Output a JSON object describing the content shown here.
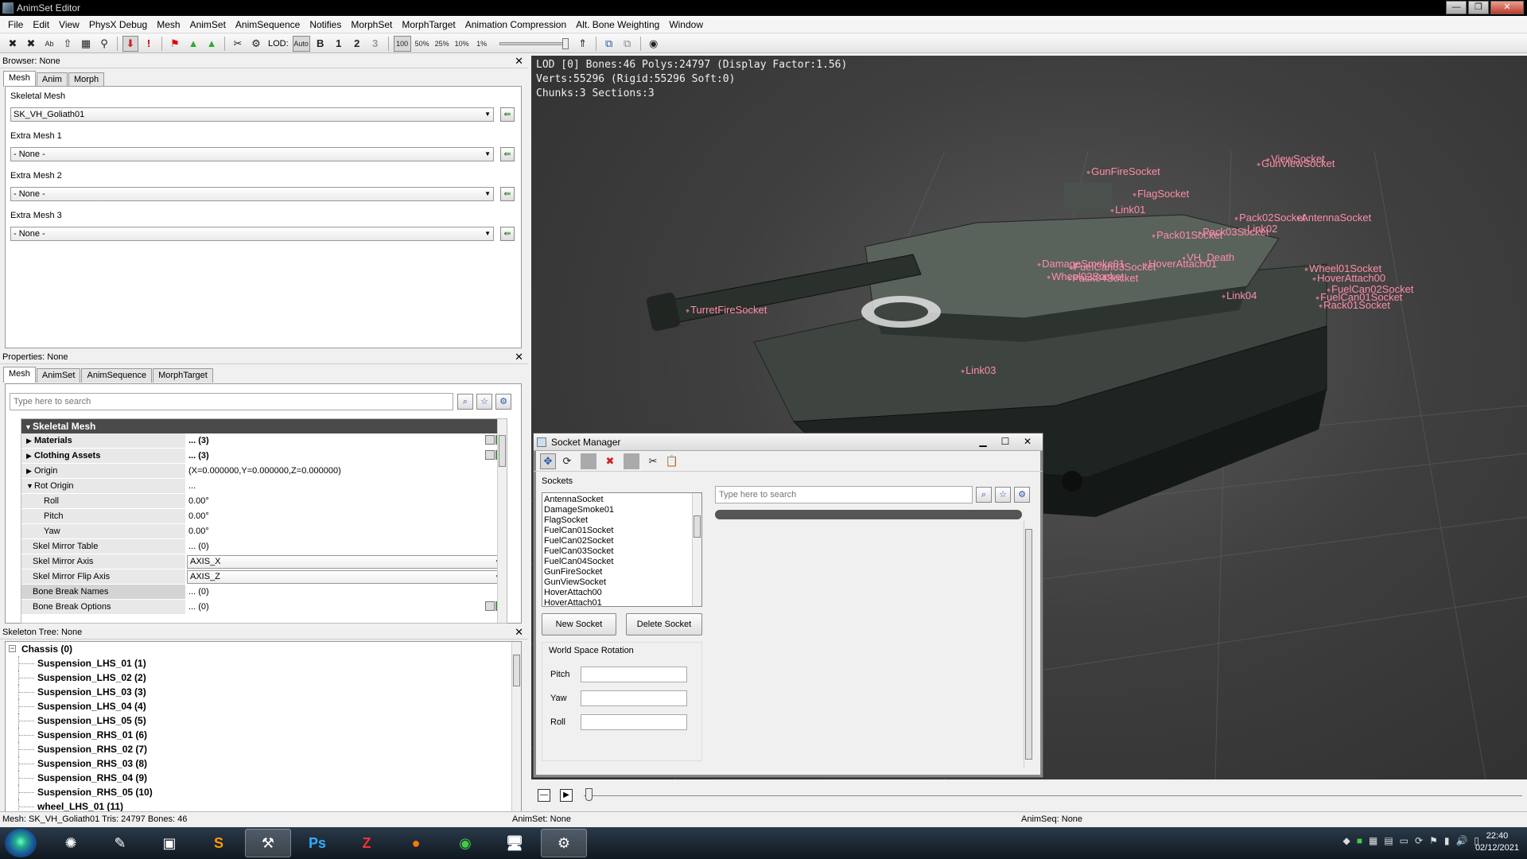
{
  "window": {
    "title": "AnimSet Editor"
  },
  "menu": [
    "File",
    "Edit",
    "View",
    "PhysX Debug",
    "Mesh",
    "AnimSet",
    "AnimSequence",
    "Notifies",
    "MorphSet",
    "MorphTarget",
    "Animation Compression",
    "Alt. Bone Weighting",
    "Window"
  ],
  "toolbar": {
    "lod_label": "LOD:",
    "lod_auto": "Auto",
    "lod_base": "B",
    "lod_1": "1",
    "lod_2": "2",
    "lod_3": "3",
    "zoom_100": "100",
    "zoom_50": "50%",
    "zoom_25": "25%",
    "zoom_10": "10%",
    "zoom_1": "1%"
  },
  "browser": {
    "title": "Browser: None",
    "tabs": [
      "Mesh",
      "Anim",
      "Morph"
    ],
    "fields": [
      {
        "label": "Skeletal Mesh",
        "value": "SK_VH_Goliath01"
      },
      {
        "label": "Extra Mesh 1",
        "value": "- None -"
      },
      {
        "label": "Extra Mesh 2",
        "value": "- None -"
      },
      {
        "label": "Extra Mesh 3",
        "value": "- None -"
      }
    ]
  },
  "properties": {
    "title": "Properties: None",
    "tabs": [
      "Mesh",
      "AnimSet",
      "AnimSequence",
      "MorphTarget"
    ],
    "search_placeholder": "Type here to search",
    "category": "Skeletal Mesh",
    "rows": [
      {
        "name": "Materials",
        "value": "... (3)"
      },
      {
        "name": "Clothing Assets",
        "value": "... (3)"
      },
      {
        "name": "Origin",
        "value": "(X=0.000000,Y=0.000000,Z=0.000000)"
      },
      {
        "name": "Rot Origin",
        "value": "..."
      },
      {
        "name": "Roll",
        "value": "0.00°"
      },
      {
        "name": "Pitch",
        "value": "0.00°"
      },
      {
        "name": "Yaw",
        "value": "0.00°"
      },
      {
        "name": "Skel Mirror Table",
        "value": "... (0)"
      },
      {
        "name": "Skel Mirror Axis",
        "value": "AXIS_X"
      },
      {
        "name": "Skel Mirror Flip Axis",
        "value": "AXIS_Z"
      },
      {
        "name": "Bone Break Names",
        "value": "... (0)"
      },
      {
        "name": "Bone Break Options",
        "value": "... (0)"
      }
    ]
  },
  "skeleton": {
    "title": "Skeleton Tree: None",
    "root": "Chassis (0)",
    "items": [
      "Suspension_LHS_01 (1)",
      "Suspension_LHS_02 (2)",
      "Suspension_LHS_03 (3)",
      "Suspension_LHS_04 (4)",
      "Suspension_LHS_05 (5)",
      "Suspension_RHS_01 (6)",
      "Suspension_RHS_02 (7)",
      "Suspension_RHS_03 (8)",
      "Suspension_RHS_04 (9)",
      "Suspension_RHS_05 (10)",
      "wheel_LHS_01 (11)"
    ]
  },
  "viewport": {
    "stats": [
      "LOD [0] Bones:46 Polys:24797 (Display Factor:1.56)",
      "Verts:55296 (Rigid:55296 Soft:0)",
      "Chunks:3 Sections:3"
    ],
    "sockets": [
      "GunFireSocket",
      "ViewSocket",
      "GunViewSocket",
      "FlagSocket",
      "Link01",
      "Pack02Socket",
      "AntennaSocket",
      "Link02",
      "Pack01Socket",
      "Pack03Socket",
      "VH_Death",
      "DamageSmoke01",
      "HoverAttach01",
      "FuelCan03Socket",
      "Wheel02Socket",
      "Pack04Socket",
      "Wheel01Socket",
      "HoverAttach00",
      "FuelCan02Socket",
      "FuelCan01Socket",
      "Rack01Socket",
      "Link04",
      "TurretFireSocket",
      "Link03"
    ]
  },
  "socket_manager": {
    "title": "Socket Manager",
    "sockets_label": "Sockets",
    "sockets": [
      "AntennaSocket",
      "DamageSmoke01",
      "FlagSocket",
      "FuelCan01Socket",
      "FuelCan02Socket",
      "FuelCan03Socket",
      "FuelCan04Socket",
      "GunFireSocket",
      "GunViewSocket",
      "HoverAttach00",
      "HoverAttach01"
    ],
    "new_socket": "New Socket",
    "delete_socket": "Delete Socket",
    "rotation_title": "World Space Rotation",
    "pitch": "Pitch",
    "yaw": "Yaw",
    "roll": "Roll",
    "search_placeholder": "Type here to search"
  },
  "statusbar": {
    "mesh": "Mesh: SK_VH_Goliath01  Tris: 24797  Bones: 46",
    "animset": "AnimSet: None",
    "animseq": "AnimSeq: None"
  },
  "taskbar": {
    "time": "22:40",
    "date": "02/12/2021",
    "ps_label": "Ps"
  }
}
